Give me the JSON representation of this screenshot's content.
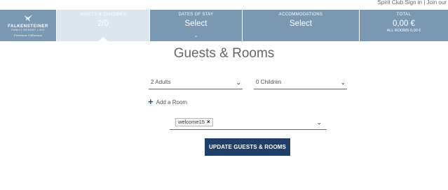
{
  "topbar": {
    "text": "Spirit Club Sign in | Join our"
  },
  "logo": {
    "name": "FALKENSTEINER",
    "sub": "FAMILY RESORT LIDO",
    "script": "Premium Collection"
  },
  "steps": [
    {
      "label": "ADULTS & CHILDREN",
      "value": "2/0",
      "active": true
    },
    {
      "label": "DATES OF STAY",
      "value": "Select"
    },
    {
      "label": "ACCOMMODATIONS",
      "value": "Select"
    },
    {
      "label": "TOTAL",
      "value": "0,00 €",
      "sub": "ALL ROOMS 0,00 €"
    }
  ],
  "page": {
    "title": "Guests & Rooms"
  },
  "form": {
    "adults": "2 Adults",
    "children": "0 Children",
    "add_room": "Add a Room",
    "promo_tag": "welcome15",
    "submit": "UPDATE GUESTS & ROOMS"
  },
  "colors": {
    "header_bg": "#7b98b3",
    "active_step_bg": "#dce6ef",
    "button_bg": "#1f3f6b"
  }
}
